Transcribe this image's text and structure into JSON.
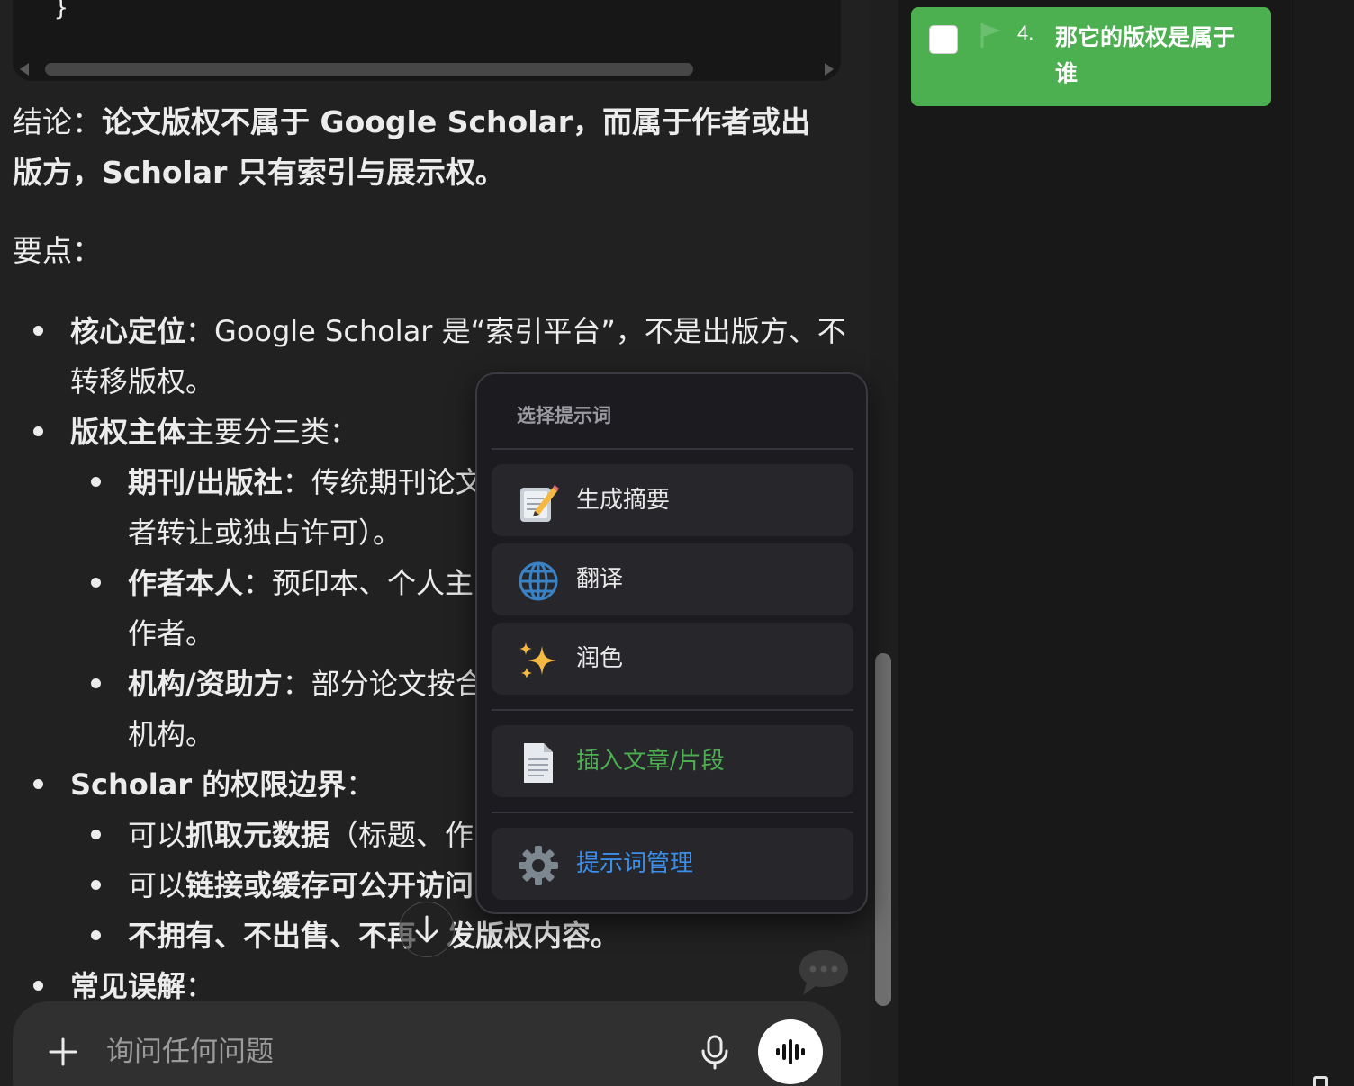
{
  "code_block": {
    "closing_brace": "}"
  },
  "answer": {
    "conclusion_prefix": "结论：",
    "conclusion_bold": "论文版权不属于 Google Scholar，而属于作者或出版方，Scholar 只有索引与展示权。",
    "keypoints_heading": "要点：",
    "items": [
      {
        "bold": "核心定位",
        "text": "：Google Scholar 是“索引平台”，不是出版方、不"
      },
      {
        "bold": "",
        "text": "转移版权。"
      },
      {
        "bold": "版权主体",
        "text": "主要分三类："
      },
      {
        "bold": "期刊/出版社",
        "text": "：传统期刊论文"
      },
      {
        "bold": "",
        "text": "者转让或独占许可）。"
      },
      {
        "bold": "作者本人",
        "text": "：预印本、个人主"
      },
      {
        "bold": "",
        "text": "作者。"
      },
      {
        "bold": "机构/资助方",
        "text": "：部分论文按合"
      },
      {
        "bold": "",
        "text": "机构。"
      },
      {
        "bold": "Scholar 的权限边界",
        "text": "："
      },
      {
        "prefix": "可以",
        "bold": "抓取元数据",
        "text": "（标题、作"
      },
      {
        "prefix": "可以",
        "bold": "链接或缓存可公开访问",
        "text": ""
      },
      {
        "bold": "不拥有、不出售、不再",
        "text": ""
      },
      {
        "bold": "发版权内容。",
        "text": ""
      },
      {
        "bold": "常见误解",
        "text": "："
      }
    ]
  },
  "composer": {
    "placeholder": "询问任何问题",
    "plus_icon": "plus-icon",
    "mic_icon": "microphone-icon",
    "voice_icon": "voice-waveform-icon"
  },
  "popup": {
    "title": "选择提示词",
    "items": [
      {
        "label": "生成摘要",
        "icon": "memo-pencil-icon",
        "color": "#e8e8e8"
      },
      {
        "label": "翻译",
        "icon": "globe-icon",
        "color": "#e8e8e8"
      },
      {
        "label": "润色",
        "icon": "sparkles-icon",
        "color": "#e8e8e8"
      },
      {
        "label": "插入文章/片段",
        "icon": "document-icon",
        "color": "#4caf50"
      },
      {
        "label": "提示词管理",
        "icon": "gear-icon",
        "color": "#3b8eea"
      }
    ]
  },
  "sidebar": {
    "question_number": "4.",
    "question_text": "那它的版权是属于谁",
    "card_color": "#4caf50"
  }
}
